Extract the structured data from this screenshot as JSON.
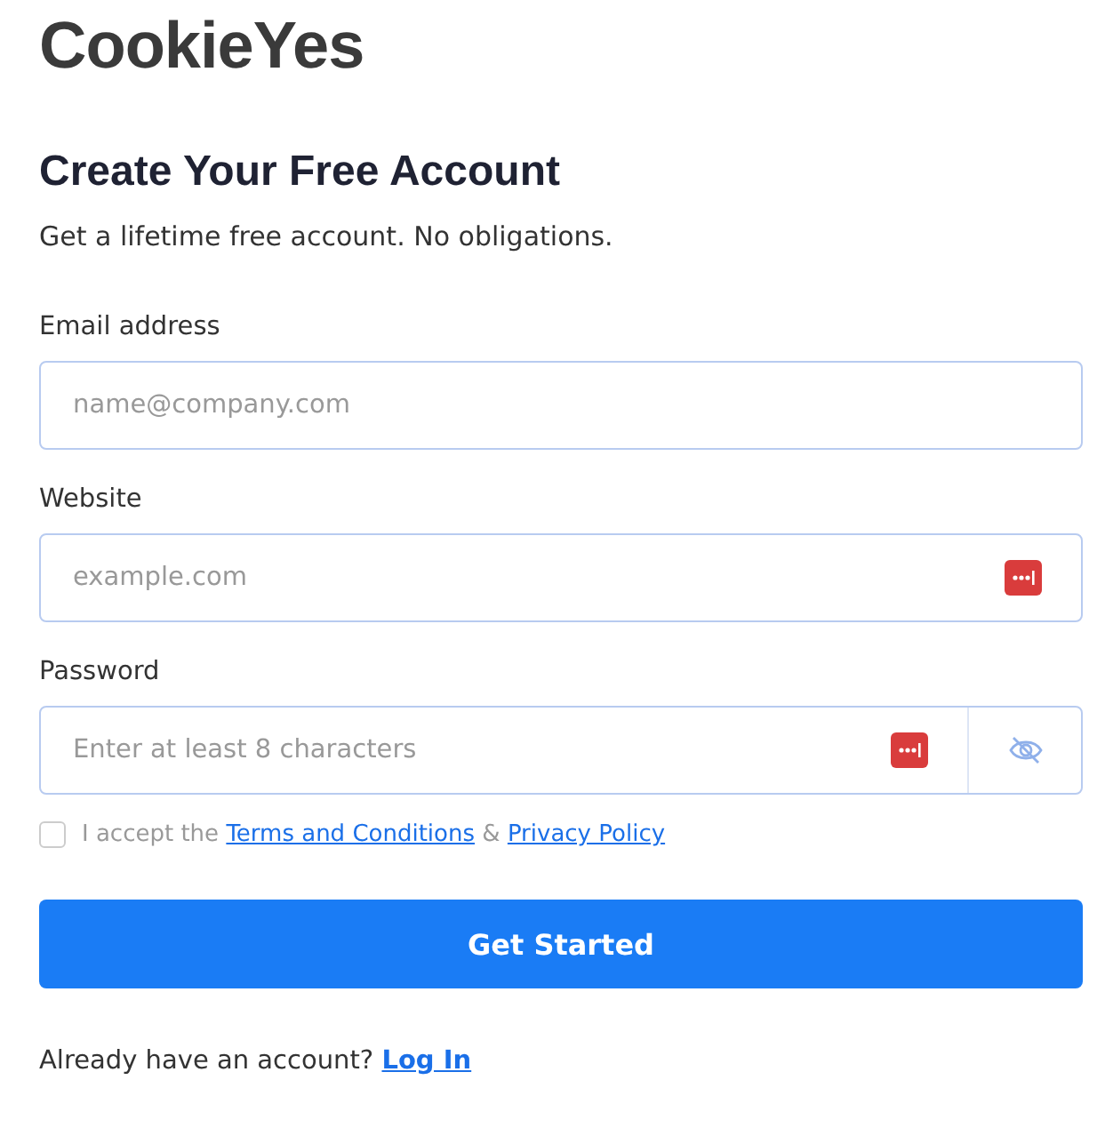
{
  "logo": "CookieYes",
  "heading": "Create Your Free Account",
  "subtitle": "Get a lifetime free account. No obligations.",
  "fields": [
    {
      "label": "Email address",
      "placeholder": "name@company.com",
      "kind": "plain"
    },
    {
      "label": "Website",
      "placeholder": "example.com",
      "kind": "autofill"
    },
    {
      "label": "Password",
      "placeholder": "Enter at least 8 characters",
      "kind": "password"
    }
  ],
  "consent": {
    "checked": false,
    "text": "I accept the",
    "terms_link": "Terms and Conditions",
    "joiner": "&",
    "privacy_link": "Privacy Policy"
  },
  "submit_button": "Get Started",
  "footer": {
    "text": "Already have an account?",
    "link": "Log In"
  }
}
